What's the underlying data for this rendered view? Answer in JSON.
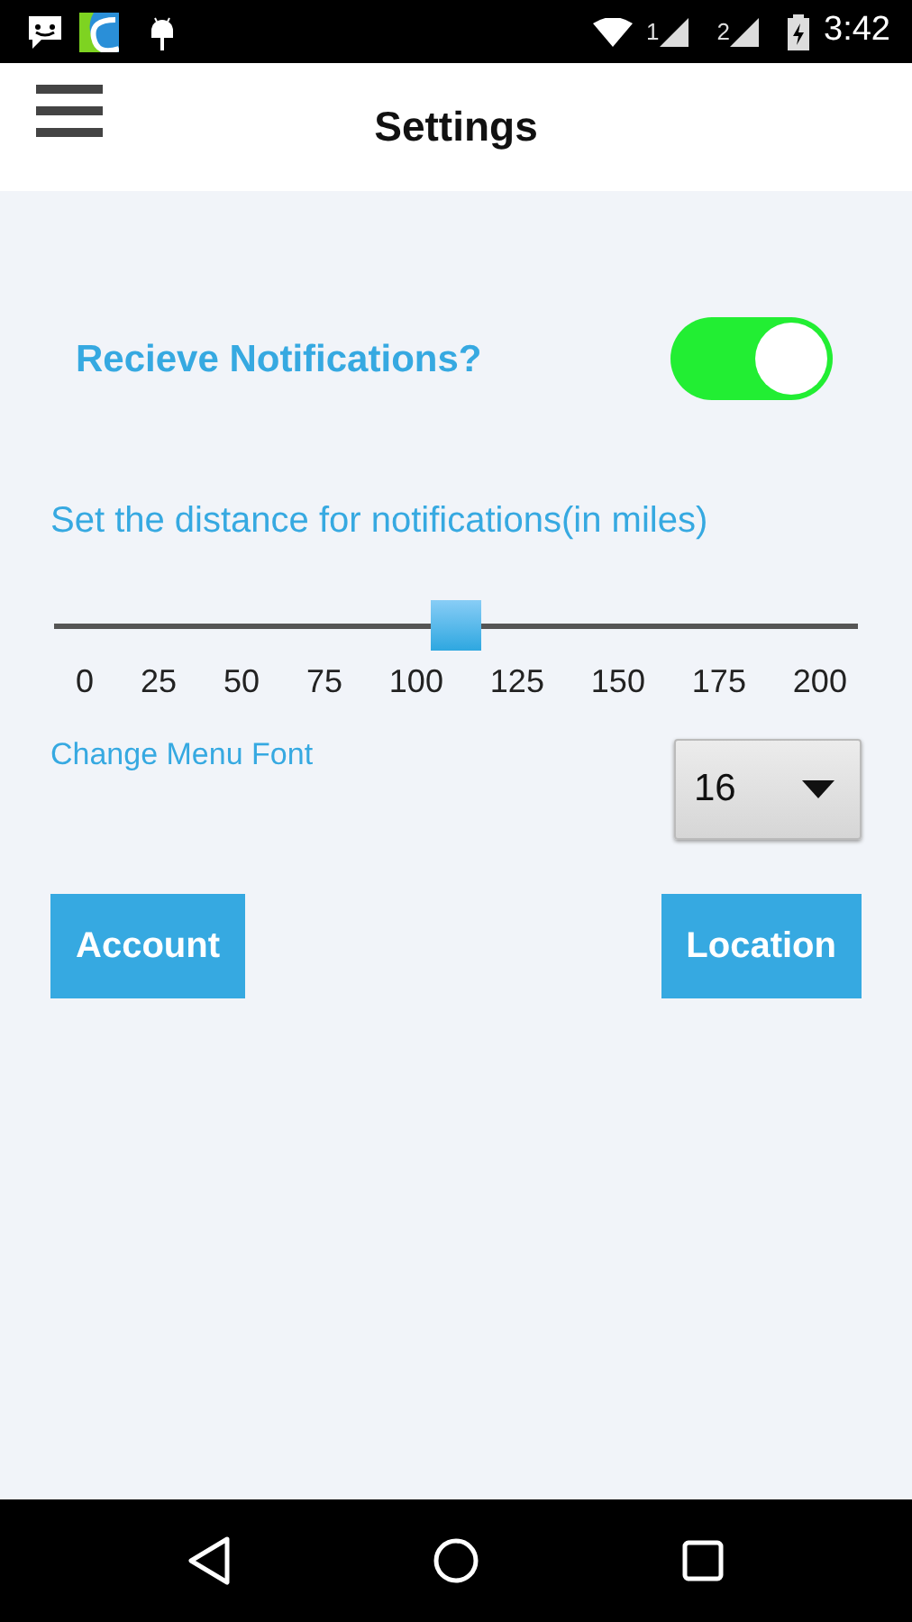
{
  "status_bar": {
    "sim_1": "1",
    "sim_2": "2",
    "time": "3:42"
  },
  "app_bar": {
    "title": "Settings"
  },
  "notifications": {
    "label": "Recieve Notifications?",
    "on": true
  },
  "distance": {
    "label": "Set the distance for notifications(in miles)",
    "level": 0.5,
    "ticks": [
      "0",
      "25",
      "50",
      "75",
      "100",
      "125",
      "150",
      "175",
      "200"
    ]
  },
  "menu_font": {
    "label": "Change Menu Font",
    "value": "16"
  },
  "buttons": [
    "Account",
    "Location"
  ]
}
